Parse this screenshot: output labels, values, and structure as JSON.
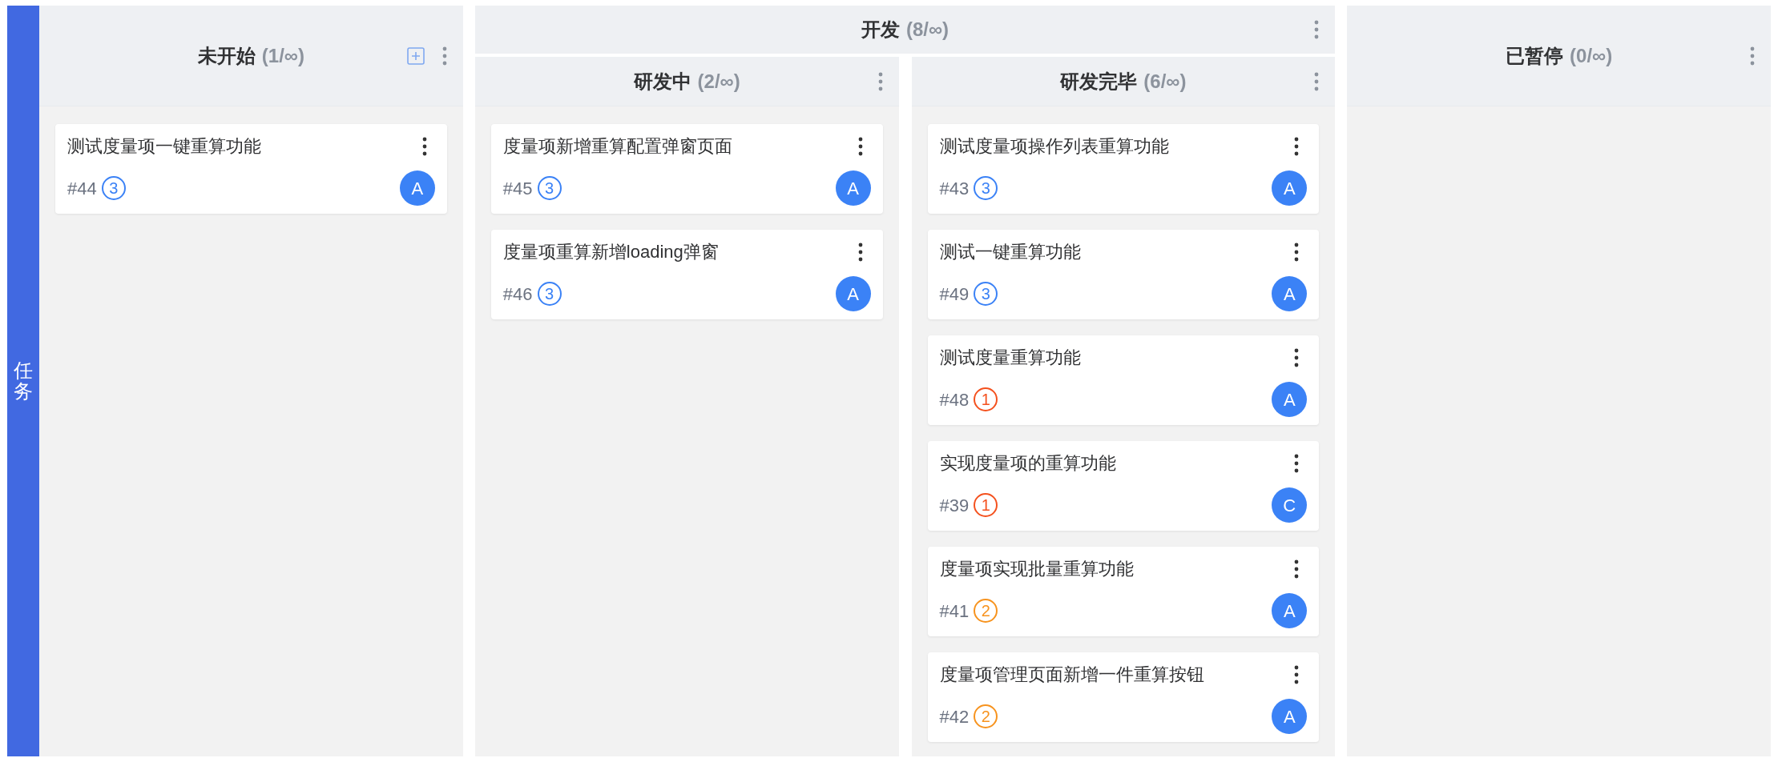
{
  "swimlane": {
    "label": "任务"
  },
  "columns": [
    {
      "kind": "column",
      "title": "未开始",
      "count": "(1/∞)",
      "add_button": true,
      "cards": [
        {
          "title": "测试度量项一键重算功能",
          "id": "#44",
          "priority": "3",
          "color": "#3b82f6",
          "assignee": "A"
        }
      ]
    },
    {
      "kind": "group",
      "title": "开发",
      "count": "(8/∞)",
      "children": [
        {
          "title": "研发中",
          "count": "(2/∞)",
          "cards": [
            {
              "title": "度量项新增重算配置弹窗页面",
              "id": "#45",
              "priority": "3",
              "color": "#3b82f6",
              "assignee": "A"
            },
            {
              "title": "度量项重算新增loading弹窗",
              "id": "#46",
              "priority": "3",
              "color": "#3b82f6",
              "assignee": "A"
            }
          ]
        },
        {
          "title": "研发完毕",
          "count": "(6/∞)",
          "cards": [
            {
              "title": "测试度量项操作列表重算功能",
              "id": "#43",
              "priority": "3",
              "color": "#3b82f6",
              "assignee": "A"
            },
            {
              "title": "测试一键重算功能",
              "id": "#49",
              "priority": "3",
              "color": "#3b82f6",
              "assignee": "A"
            },
            {
              "title": "测试度量重算功能",
              "id": "#48",
              "priority": "1",
              "color": "#f4511e",
              "assignee": "A"
            },
            {
              "title": "实现度量项的重算功能",
              "id": "#39",
              "priority": "1",
              "color": "#f4511e",
              "assignee": "C"
            },
            {
              "title": "度量项实现批量重算功能",
              "id": "#41",
              "priority": "2",
              "color": "#f7931e",
              "assignee": "A"
            },
            {
              "title": "度量项管理页面新增一件重算按钮",
              "id": "#42",
              "priority": "2",
              "color": "#f7931e",
              "assignee": "A"
            }
          ]
        }
      ]
    },
    {
      "kind": "column",
      "title": "已暂停",
      "count": "(0/∞)"
    }
  ]
}
